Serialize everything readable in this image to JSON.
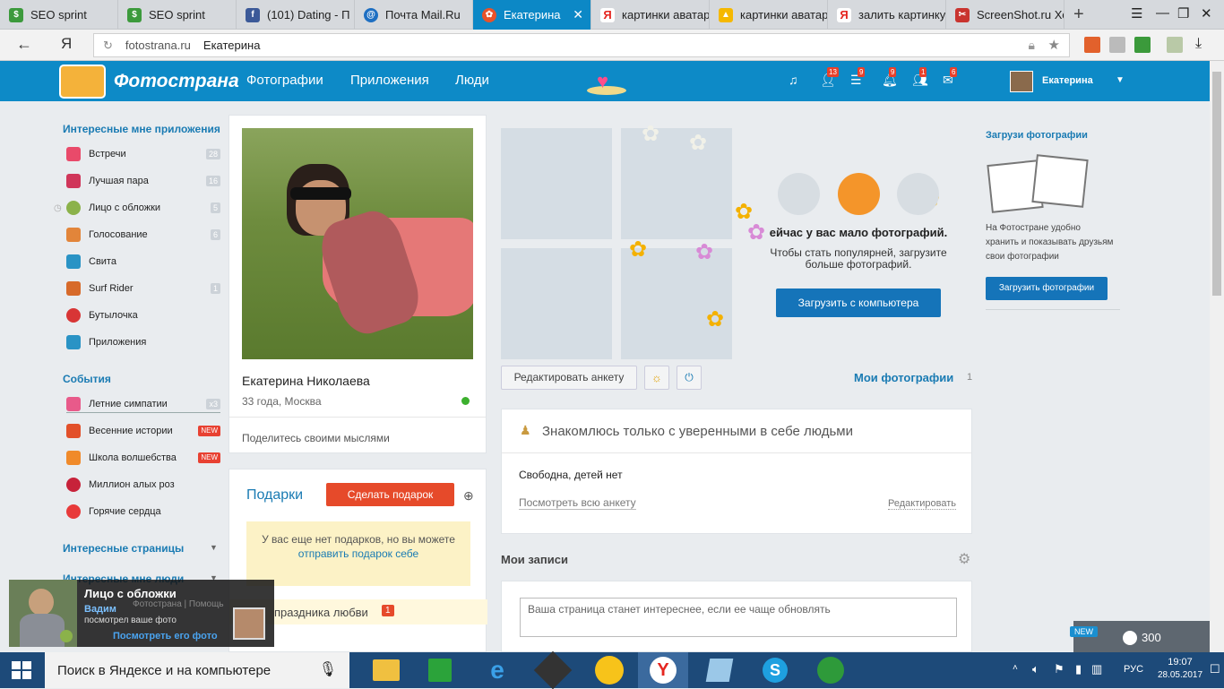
{
  "browser": {
    "tabs": [
      {
        "title": "SEO sprint",
        "icon": "seo-sprint-icon",
        "color": "#3c9a3c"
      },
      {
        "title": "SEO sprint",
        "icon": "seo-sprint-icon",
        "color": "#3c9a3c"
      },
      {
        "title": "(101) Dating - П",
        "icon": "facebook-icon",
        "color": "#3b5998"
      },
      {
        "title": "Почта Mail.Ru",
        "icon": "mail-ru-icon",
        "color": "#1e6fc2"
      },
      {
        "title": "Екатерина",
        "icon": "fotostrana-icon",
        "color": "#e8522a",
        "active": true
      },
      {
        "title": "картинки аватар",
        "icon": "yandex-icon",
        "color": "#e52620"
      },
      {
        "title": "картинки аватар",
        "icon": "yandex-images-icon",
        "color": "#f5b800"
      },
      {
        "title": "залить картинку",
        "icon": "yandex-icon",
        "color": "#e52620"
      },
      {
        "title": "ScreenShot.ru Хо",
        "icon": "screenshot-ru-icon",
        "color": "#c9342f"
      }
    ],
    "address": {
      "domain": "fotostrana.ru",
      "page_title": "Екатерина"
    }
  },
  "site": {
    "logo": "Фотострана",
    "nav": [
      "Фотографии",
      "Приложения",
      "Люди"
    ],
    "header_icons": [
      {
        "icon": "music-icon",
        "badge": ""
      },
      {
        "icon": "friends-icon",
        "badge": "13"
      },
      {
        "icon": "list-icon",
        "badge": "9"
      },
      {
        "icon": "bell-icon",
        "badge": "9"
      },
      {
        "icon": "guests-icon",
        "badge": "1"
      },
      {
        "icon": "mail-icon",
        "badge": "6"
      }
    ],
    "user_name": "Екатерина"
  },
  "sidebar": {
    "apps_title": "Интересные мне приложения",
    "apps": [
      {
        "label": "Встречи",
        "count": "28",
        "color": "#e94a6a"
      },
      {
        "label": "Лучшая пара",
        "count": "16",
        "color": "#d0365a"
      },
      {
        "label": "Лицо с обложки",
        "count": "5",
        "color": "#8bb24a"
      },
      {
        "label": "Голосование",
        "count": "6",
        "color": "#e2853a"
      },
      {
        "label": "Свита",
        "count": "",
        "color": "#2a93c5"
      },
      {
        "label": "Surf Rider",
        "count": "1",
        "color": "#d76a2a"
      },
      {
        "label": "Бутылочка",
        "count": "",
        "color": "#d83535"
      },
      {
        "label": "Приложения",
        "count": "",
        "color": "#2a93c5"
      }
    ],
    "events_title": "События",
    "events": [
      {
        "label": "Летние симпатии",
        "badge": "x3",
        "color": "#e85a8a"
      },
      {
        "label": "Весенние истории",
        "badge": "NEW",
        "color": "#e2502a"
      },
      {
        "label": "Школа волшебства",
        "badge": "NEW",
        "color": "#f08a2a"
      },
      {
        "label": "Миллион алых роз",
        "badge": "",
        "color": "#c7223a"
      },
      {
        "label": "Горячие сердца",
        "badge": "",
        "color": "#e83a3a"
      }
    ],
    "pages_title": "Интересные страницы",
    "people_title": "Интересные мне люди"
  },
  "profile": {
    "name": "Екатерина Николаева",
    "meta": "33 года, Москва",
    "status_prompt": "Поделитесь своими мыслями"
  },
  "gifts": {
    "title": "Подарки",
    "button": "Сделать подарок",
    "empty_line1": "У вас еще нет подарков, но вы можете",
    "empty_link": "отправить подарок себе",
    "holiday": "праздника любви",
    "holiday_badge": "1"
  },
  "photos_promo": {
    "headline": "ейчас у вас мало фотографий.",
    "text": "Чтобы стать популярней, загрузите больше фотографий.",
    "upload_button": "Загрузить с компьютера",
    "edit_button": "Редактировать анкету",
    "my_photos": "Мои фотографии",
    "my_photos_count": "1"
  },
  "about": {
    "headline": "Знакомлюсь только с уверенными в себе людьми",
    "status": "Свободна, детей нет",
    "view_all": "Посмотреть всю анкету",
    "edit": "Редактировать"
  },
  "posts": {
    "title": "Мои записи",
    "placeholder": "Ваша страница станет интереснее, если ее чаще обновлять"
  },
  "right_panel": {
    "title": "Загрузи фотографии",
    "text": "На Фотостране удобно хранить и показывать друзьям свои фотографии",
    "button": "Загрузить фотографии"
  },
  "notification": {
    "title": "Лицо с обложки",
    "user": "Вадим",
    "text": "посмотрел ваше фото",
    "link": "Посмотреть его фото",
    "footer": "Фотострана | Помощь"
  },
  "coins": {
    "badge": "NEW",
    "value": "300"
  },
  "taskbar": {
    "search": "Поиск в Яндексе и на компьютере",
    "lang": "РУС",
    "time": "19:07",
    "date": "28.05.2017"
  }
}
